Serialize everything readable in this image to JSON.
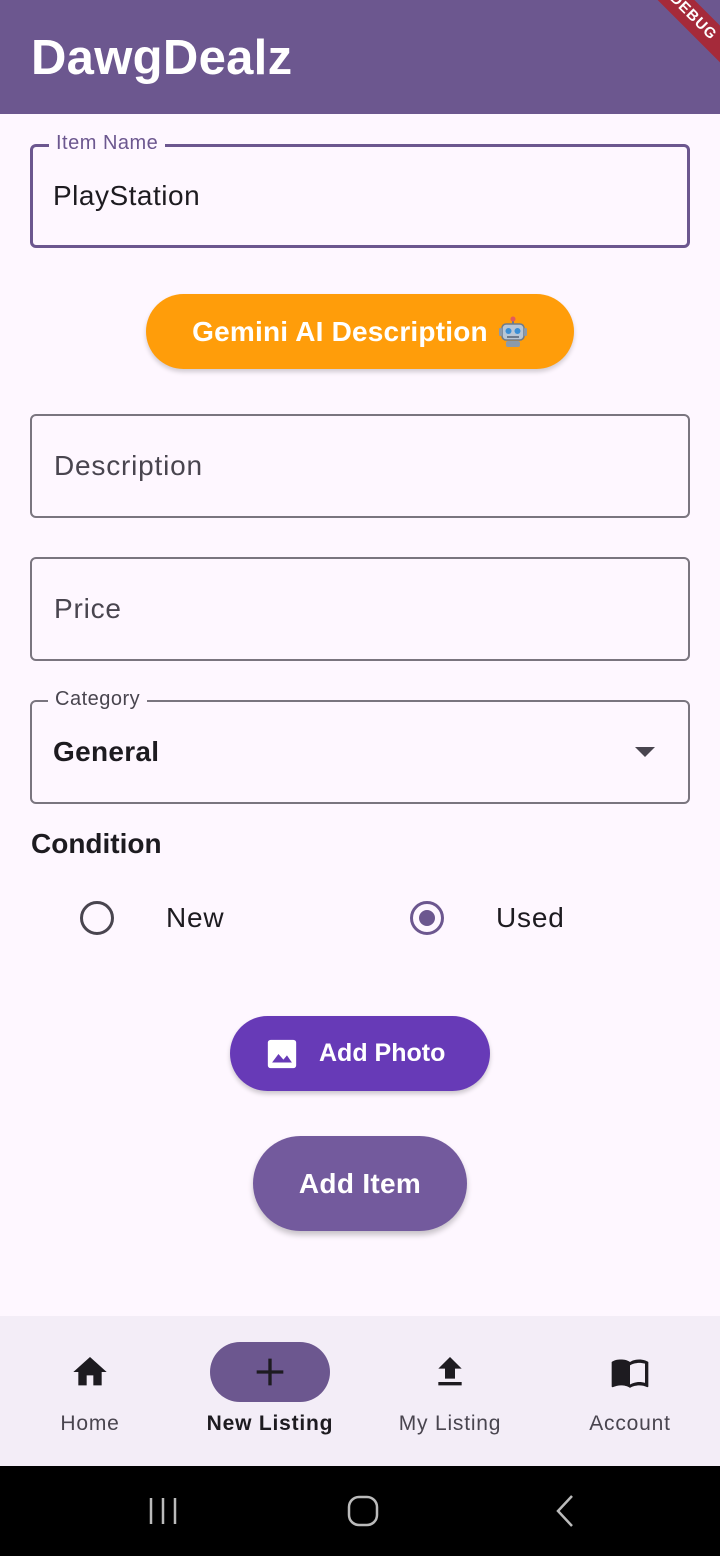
{
  "app": {
    "title": "DawgDealz",
    "debug_banner": "DEBUG"
  },
  "form": {
    "item_name": {
      "label": "Item Name",
      "value": "PlayStation"
    },
    "gemini_button": {
      "label": "Gemini AI Description",
      "icon": "robot-icon"
    },
    "description": {
      "placeholder": "Description",
      "value": ""
    },
    "price": {
      "placeholder": "Price",
      "value": ""
    },
    "category": {
      "label": "Category",
      "value": "General",
      "icon": "dropdown-arrow-icon"
    },
    "condition": {
      "heading": "Condition",
      "options": [
        {
          "label": "New",
          "selected": false
        },
        {
          "label": "Used",
          "selected": true
        }
      ]
    },
    "add_photo_button": {
      "label": "Add Photo",
      "icon": "image-icon"
    },
    "add_item_button": {
      "label": "Add Item"
    }
  },
  "bottom_nav": {
    "items": [
      {
        "label": "Home",
        "icon": "home-icon",
        "active": false
      },
      {
        "label": "New Listing",
        "icon": "add-icon",
        "active": true
      },
      {
        "label": "My Listing",
        "icon": "upload-icon",
        "active": false
      },
      {
        "label": "Account",
        "icon": "book-icon",
        "active": false
      }
    ]
  },
  "colors": {
    "primary": "#6C578F",
    "gemini_orange": "#FF9D0A",
    "photo_purple": "#673AB7",
    "background": "#FEF7FF",
    "nav_background": "#F3EDF7"
  }
}
